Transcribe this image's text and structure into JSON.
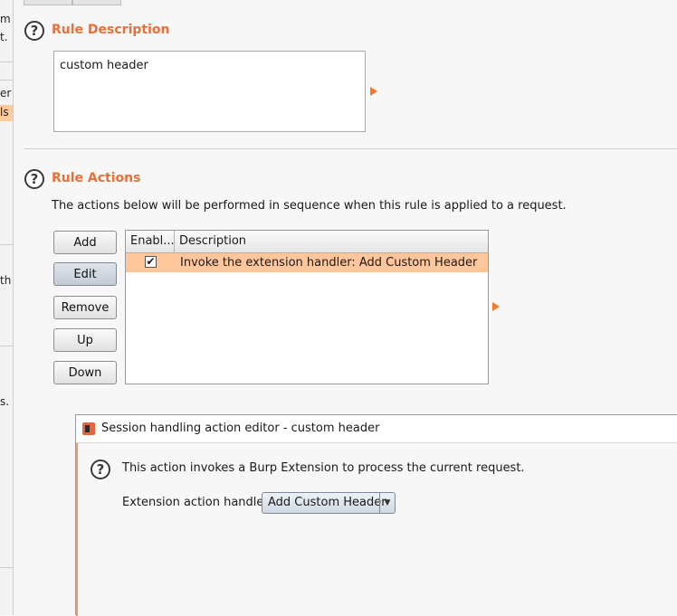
{
  "left_panel": {
    "fragments": [
      "m",
      "t.",
      "er",
      "ls",
      "th",
      "s."
    ]
  },
  "rule_description": {
    "title": "Rule Description",
    "text": "custom header"
  },
  "rule_actions": {
    "title": "Rule Actions",
    "intro": "The actions below will be performed in sequence when this rule is applied to a request.",
    "buttons": {
      "add": "Add",
      "edit": "Edit",
      "remove": "Remove",
      "up": "Up",
      "down": "Down"
    },
    "table": {
      "columns": [
        "Enabl...",
        "Description"
      ],
      "rows": [
        {
          "enabled": true,
          "check_glyph": "✔",
          "description": "Invoke the extension handler: Add Custom Header"
        }
      ]
    }
  },
  "dialog": {
    "title": "Session handling action editor - custom header",
    "info": "This action invokes a Burp Extension to process the current request.",
    "handler_label": "Extension action handler:",
    "handler_value": "Add Custom Header",
    "dropdown_glyph": "▼"
  },
  "icons": {
    "help": "question-mark-icon",
    "expand": "orange-arrow-icon",
    "app": "burp-suite-icon"
  },
  "colors": {
    "section_title": "#e8703a",
    "selected_row": "#ffc69c",
    "arrow": "#f07a2e"
  }
}
